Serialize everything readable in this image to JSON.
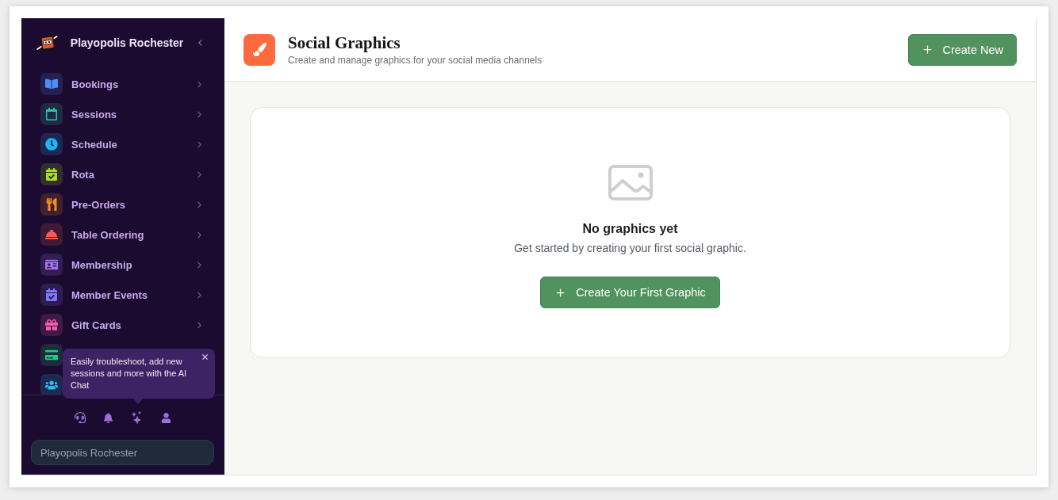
{
  "sidebar": {
    "brand": {
      "name": "Playopolis Rochester"
    },
    "items": [
      {
        "label": "Bookings",
        "color": "#4d8ef2"
      },
      {
        "label": "Sessions",
        "color": "#2ec4a6"
      },
      {
        "label": "Schedule",
        "color": "#1fb4f4"
      },
      {
        "label": "Rota",
        "color": "#a4e01c"
      },
      {
        "label": "Pre-Orders",
        "color": "#f78d1f"
      },
      {
        "label": "Table Ordering",
        "color": "#f25d55"
      },
      {
        "label": "Membership",
        "color": "#a273f0"
      },
      {
        "label": "Member Events",
        "color": "#7b78f4"
      },
      {
        "label": "Gift Cards",
        "color": "#f25ca9"
      },
      {
        "color": "#22c77d"
      },
      {
        "color": "#1ec4ee"
      }
    ],
    "tooltip": {
      "text": "Easily troubleshoot, add new sessions and more with the AI Chat"
    },
    "location_field": {
      "value": "Playopolis Rochester"
    }
  },
  "header": {
    "title": "Social Graphics",
    "subtitle": "Create and manage graphics for your social media channels",
    "button": {
      "label": "Create New"
    }
  },
  "empty_state": {
    "title": "No graphics yet",
    "message": "Get started by creating your first social graphic.",
    "button": {
      "label": "Create Your First Graphic"
    }
  }
}
